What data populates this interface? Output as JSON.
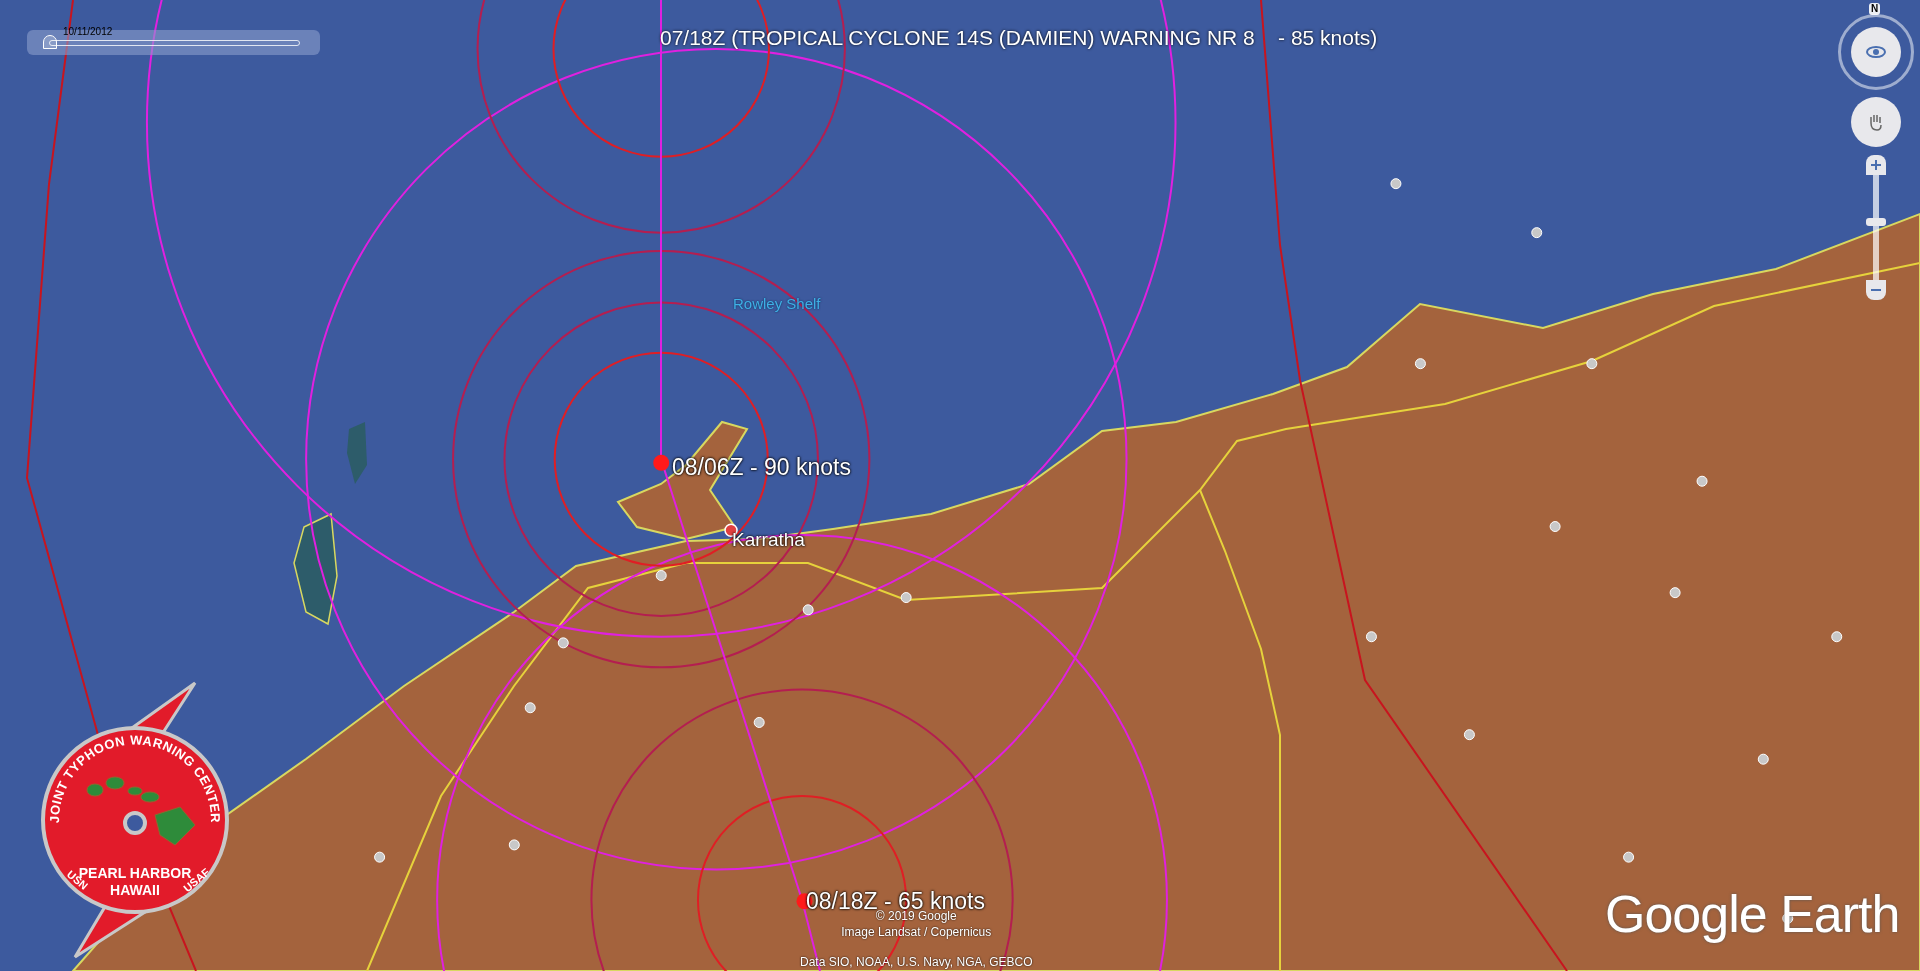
{
  "timeline": {
    "date": "10/11/2012",
    "level": 0.0
  },
  "title": "07/18Z (TROPICAL CYCLONE 14S (DAMIEN) WARNING NR 8    - 85 knots)",
  "navigation": {
    "compass_label": "N",
    "zoom": {
      "level": 0.55
    }
  },
  "map_labels": [
    {
      "kind": "place",
      "text": "Rowley Shelf"
    },
    {
      "kind": "forecast",
      "text": "08/06Z - 90 knots"
    },
    {
      "kind": "town",
      "text": "Karratha"
    },
    {
      "kind": "forecast",
      "text": "08/18Z - 65 knots"
    }
  ],
  "attribution": [
    "© 2019 Google",
    "Image Landsat / Copernicus",
    "Data SIO, NOAA, U.S. Navy, NGA, GEBCO"
  ],
  "logo": {
    "ring_text": "JOINT TYPHOON WARNING CENTER",
    "location": [
      "PEARL HARBOR",
      "HAWAII"
    ],
    "left_text": "USN",
    "right_text": "USAF"
  },
  "brand": "Google Earth"
}
